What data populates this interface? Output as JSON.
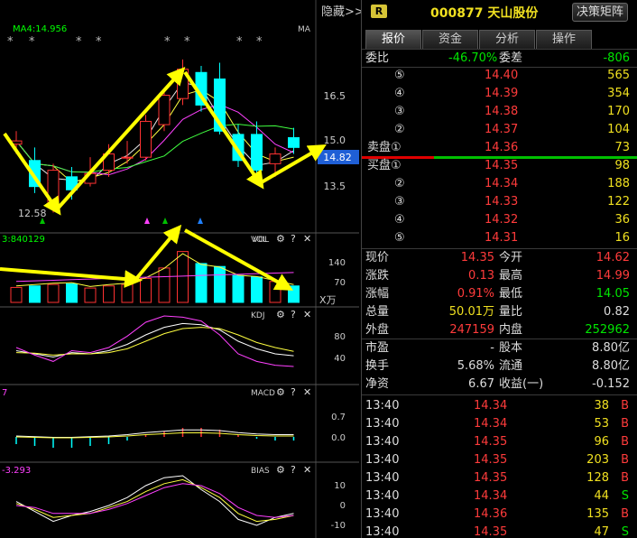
{
  "app": {
    "hide_label": "隐藏>>"
  },
  "stock": {
    "badge": "R",
    "title": "000877 天山股份",
    "decision_button": "决策矩阵"
  },
  "tabs": [
    {
      "label": "报价",
      "active": true
    },
    {
      "label": "资金",
      "active": false
    },
    {
      "label": "分析",
      "active": false
    },
    {
      "label": "操作",
      "active": false
    }
  ],
  "weibi": {
    "label": "委比",
    "value": "-46.70%",
    "diff_label": "委差",
    "diff": "-806"
  },
  "asks": [
    {
      "label": "⑤",
      "price": "14.40",
      "vol": "565"
    },
    {
      "label": "④",
      "price": "14.39",
      "vol": "354"
    },
    {
      "label": "③",
      "price": "14.38",
      "vol": "170"
    },
    {
      "label": "②",
      "price": "14.37",
      "vol": "104"
    },
    {
      "label": "卖盘①",
      "price": "14.36",
      "vol": "73"
    }
  ],
  "bids": [
    {
      "label": "买盘①",
      "price": "14.35",
      "vol": "98"
    },
    {
      "label": "②",
      "price": "14.34",
      "vol": "188"
    },
    {
      "label": "③",
      "price": "14.33",
      "vol": "122"
    },
    {
      "label": "④",
      "price": "14.32",
      "vol": "36"
    },
    {
      "label": "⑤",
      "price": "14.31",
      "vol": "16"
    }
  ],
  "quote": {
    "rows": [
      [
        {
          "l": "现价",
          "v": "14.35",
          "c": "red"
        },
        {
          "l": "今开",
          "v": "14.62",
          "c": "red"
        }
      ],
      [
        {
          "l": "涨跌",
          "v": "0.13",
          "c": "red"
        },
        {
          "l": "最高",
          "v": "14.99",
          "c": "red"
        }
      ],
      [
        {
          "l": "涨幅",
          "v": "0.91%",
          "c": "red"
        },
        {
          "l": "最低",
          "v": "14.05",
          "c": "green"
        }
      ],
      [
        {
          "l": "总量",
          "v": "50.01万",
          "c": "yellow"
        },
        {
          "l": "量比",
          "v": "0.82",
          "c": "white"
        }
      ],
      [
        {
          "l": "外盘",
          "v": "247159",
          "c": "red"
        },
        {
          "l": "内盘",
          "v": "252962",
          "c": "green"
        }
      ]
    ]
  },
  "fundamentals": {
    "rows": [
      [
        {
          "l": "市盈",
          "v": "-"
        },
        {
          "l": "股本",
          "v": "8.80亿"
        }
      ],
      [
        {
          "l": "换手",
          "v": "5.68%"
        },
        {
          "l": "流通",
          "v": "8.80亿"
        }
      ],
      [
        {
          "l": "净资",
          "v": "6.67"
        },
        {
          "l": "收益(一)",
          "v": "-0.152"
        }
      ]
    ]
  },
  "ticks": [
    {
      "time": "13:40",
      "price": "14.34",
      "vol": "38",
      "side": "B"
    },
    {
      "time": "13:40",
      "price": "14.34",
      "vol": "53",
      "side": "B"
    },
    {
      "time": "13:40",
      "price": "14.35",
      "vol": "96",
      "side": "B"
    },
    {
      "time": "13:40",
      "price": "14.35",
      "vol": "203",
      "side": "B"
    },
    {
      "time": "13:40",
      "price": "14.35",
      "vol": "128",
      "side": "B"
    },
    {
      "time": "13:40",
      "price": "14.34",
      "vol": "44",
      "side": "S"
    },
    {
      "time": "13:40",
      "price": "14.36",
      "vol": "135",
      "side": "B"
    },
    {
      "time": "13:40",
      "price": "14.35",
      "vol": "47",
      "side": "S"
    }
  ],
  "chart_data": {
    "type": "candlestick",
    "ma_label": "MA4:14.956",
    "ma_tag": "MA",
    "price_ticks": [
      "16.5",
      "15.0",
      "13.5"
    ],
    "current_price_tag": "14.82",
    "low_label": "12.58",
    "price_ylim": [
      12.2,
      17.6
    ],
    "candles": [
      {
        "o": 14.7,
        "c": 14.8,
        "h": 15.1,
        "l": 14.4
      },
      {
        "o": 14.2,
        "c": 13.4,
        "h": 14.6,
        "l": 13.2
      },
      {
        "o": 12.9,
        "c": 13.9,
        "h": 14.1,
        "l": 12.6
      },
      {
        "o": 13.7,
        "c": 13.3,
        "h": 14.0,
        "l": 13.0
      },
      {
        "o": 13.5,
        "c": 13.8,
        "h": 14.3,
        "l": 13.4
      },
      {
        "o": 13.9,
        "c": 14.4,
        "h": 14.7,
        "l": 13.7
      },
      {
        "o": 14.3,
        "c": 14.3,
        "h": 14.8,
        "l": 14.1
      },
      {
        "o": 14.3,
        "c": 15.4,
        "h": 15.6,
        "l": 14.2
      },
      {
        "o": 15.3,
        "c": 16.2,
        "h": 16.4,
        "l": 15.1
      },
      {
        "o": 16.1,
        "c": 17.0,
        "h": 17.3,
        "l": 15.9
      },
      {
        "o": 16.9,
        "c": 15.9,
        "h": 17.1,
        "l": 15.7
      },
      {
        "o": 16.7,
        "c": 15.1,
        "h": 17.2,
        "l": 15.0
      },
      {
        "o": 15.0,
        "c": 14.2,
        "h": 15.3,
        "l": 14.0
      },
      {
        "o": 15.0,
        "c": 13.9,
        "h": 15.4,
        "l": 13.6
      },
      {
        "o": 14.1,
        "c": 14.4,
        "h": 14.6,
        "l": 13.7
      },
      {
        "o": 14.9,
        "c": 14.6,
        "h": 15.2,
        "l": 14.4
      }
    ],
    "markers": [
      "*",
      "*",
      "*",
      "*",
      "*",
      "*",
      "*",
      "*"
    ],
    "vol_label": "3:840129",
    "vol_tag": "VOL",
    "vol_ticks": [
      "140",
      "70"
    ],
    "vol_unit": "X万",
    "vol_ylim": [
      0,
      190
    ],
    "volumes": [
      50,
      55,
      60,
      62,
      48,
      55,
      60,
      80,
      115,
      170,
      130,
      120,
      90,
      85,
      70,
      55
    ],
    "kdj_tag": "KDJ",
    "kdj_ticks": [
      "80",
      "40"
    ],
    "macd_tag": "MACD",
    "macd_ticks": [
      "0.7",
      "0.0"
    ],
    "bias_label": "-3.293",
    "bias_tag": "BIAS",
    "bias_ticks": [
      "10",
      "0",
      "-10"
    ],
    "pane_controls": [
      "⚙",
      "?",
      "✕"
    ]
  }
}
